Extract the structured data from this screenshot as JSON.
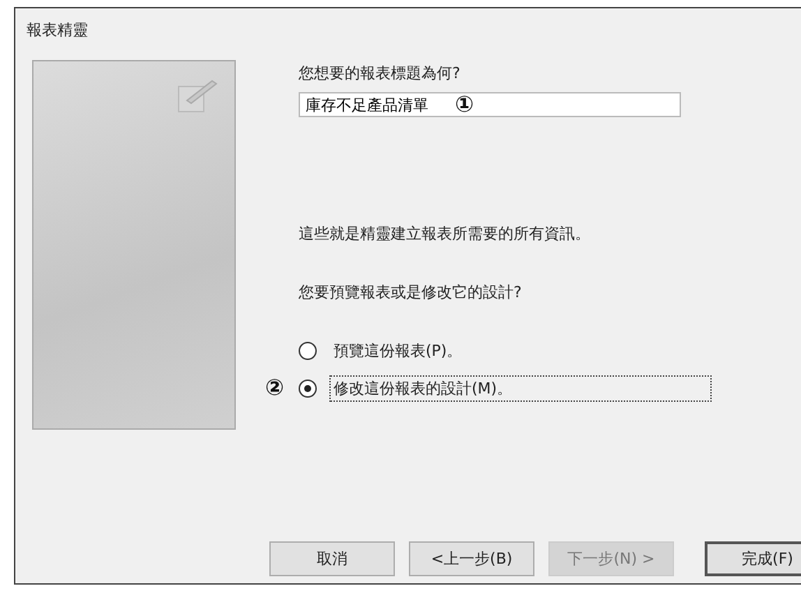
{
  "window": {
    "title": "報表精靈"
  },
  "title_prompt": "您想要的報表標題為何?",
  "title_field": {
    "value": "庫存不足產品清單"
  },
  "info_text": "這些就是精靈建立報表所需要的所有資訊。",
  "choice_prompt": "您要預覽報表或是修改它的設計?",
  "options": [
    {
      "label": "預覽這份報表(P)。",
      "selected": false
    },
    {
      "label": "修改這份報表的設計(M)。",
      "selected": true
    }
  ],
  "buttons": [
    {
      "label": "取消",
      "disabled": false,
      "default": false
    },
    {
      "label": "<上一步(B)",
      "disabled": false,
      "default": false
    },
    {
      "label": "下一步(N) >",
      "disabled": true,
      "default": false
    },
    {
      "label": "完成(F)",
      "disabled": false,
      "default": true
    }
  ],
  "callouts": [
    "①",
    "②"
  ]
}
